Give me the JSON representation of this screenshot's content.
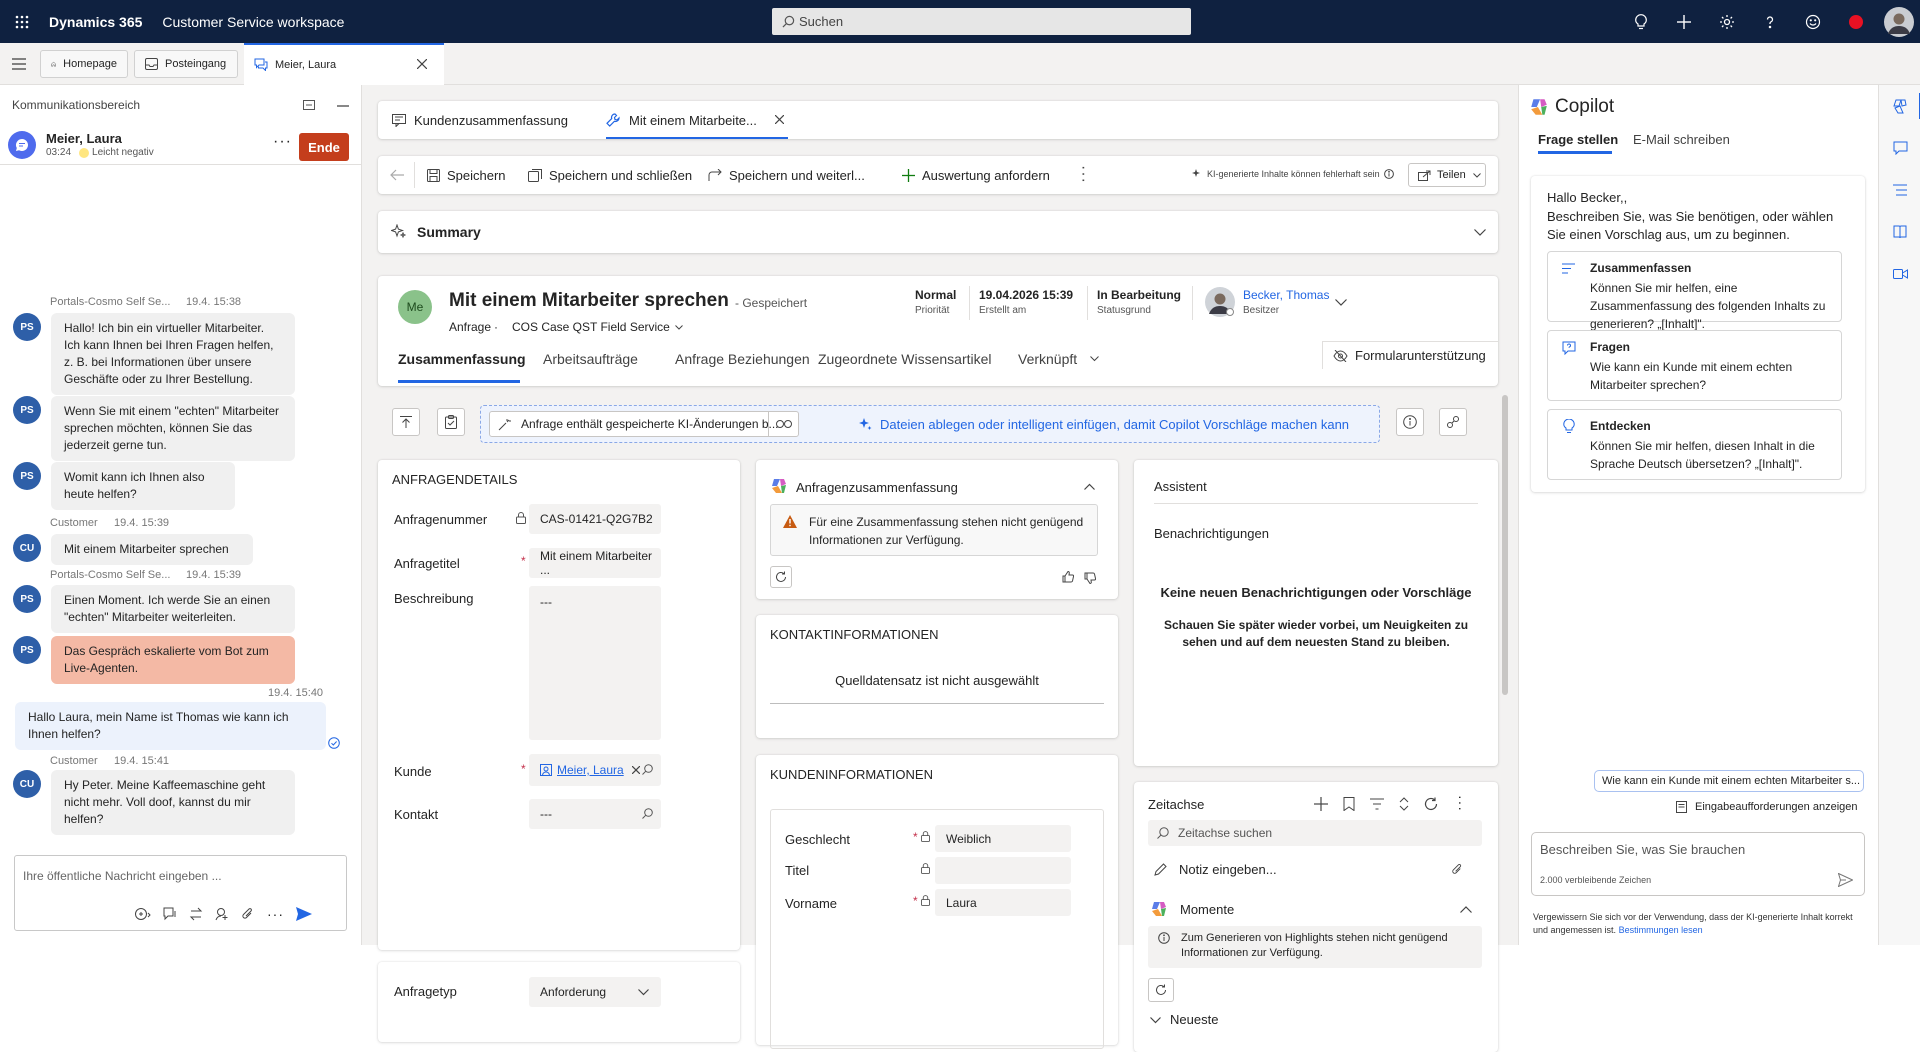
{
  "topbar": {
    "brand": "Dynamics 365",
    "app": "Customer Service workspace",
    "search_placeholder": "Suchen"
  },
  "tabs": {
    "home": "Homepage",
    "inbox": "Posteingang",
    "session": "Meier, Laura"
  },
  "comm": {
    "title": "Kommunikationsbereich",
    "contact_name": "Meier, Laura",
    "contact_time": "03:24",
    "sentiment": "Leicht negativ",
    "end_label": "Ende",
    "input_placeholder": "Ihre öffentliche Nachricht eingeben ...",
    "messages": [
      {
        "sender": "Portals-Cosmo Self Se...",
        "time": "19.4. 15:38",
        "initials": "PS",
        "text": "Hallo! Ich bin ein virtueller Mitarbeiter. Ich kann Ihnen bei Ihren Fragen helfen, z. B. bei Informationen über unsere Geschäfte oder zu Ihrer Bestellung."
      },
      {
        "initials": "PS",
        "text": "Wenn Sie mit einem \"echten\" Mitarbeiter sprechen möchten, können Sie das jederzeit gerne tun."
      },
      {
        "initials": "PS",
        "text": "Womit kann ich Ihnen also heute helfen?"
      },
      {
        "sender": "Customer",
        "time": "19.4. 15:39",
        "initials": "CU",
        "text": "Mit einem Mitarbeiter sprechen"
      },
      {
        "sender": "Portals-Cosmo Self Se...",
        "time": "19.4. 15:39",
        "initials": "PS",
        "text": "Einen Moment. Ich werde Sie an einen \"echten\" Mitarbeiter weiterleiten."
      },
      {
        "initials": "PS",
        "text": "Das Gespräch eskalierte vom Bot zum Live-Agenten."
      },
      {
        "time": "19.4. 15:40",
        "text": "Hallo Laura, mein Name ist Thomas wie kann ich Ihnen helfen?"
      },
      {
        "sender": "Customer",
        "time": "19.4. 15:41",
        "initials": "CU",
        "text": "Hy Peter. Meine Kaffeemaschine geht nicht mehr. Voll doof, kannst du mir helfen?"
      }
    ]
  },
  "form": {
    "subtabs": {
      "summary": "Kundenzusammenfassung",
      "current": "Mit einem Mitarbeite..."
    },
    "toolbar": {
      "save": "Speichern",
      "save_close": "Speichern und schließen",
      "save_next": "Speichern und weiterl...",
      "request_eval": "Auswertung anfordern",
      "ai_note": "KI-generierte Inhalte können fehlerhaft sein",
      "share": "Teilen"
    },
    "summary_label": "Summary",
    "header": {
      "initials": "Me",
      "title": "Mit einem Mitarbeiter sprechen",
      "saved": "- Gespeichert",
      "entity": "Anfrage",
      "formname": "COS Case QST Field Service",
      "priority_value": "Normal",
      "priority_label": "Priorität",
      "created_value": "19.04.2026 15:39",
      "created_label": "Erstellt am",
      "status_value": "In Bearbeitung",
      "status_label": "Statusgrund",
      "owner_value": "Becker, Thomas",
      "owner_label": "Besitzer"
    },
    "tabs": [
      "Zusammenfassung",
      "Arbeitsaufträge",
      "Anfrage Beziehungen",
      "Zugeordnete Wissensartikel",
      "Verknüpft"
    ],
    "form_assist": "Formularunterstützung",
    "ai_banner": "Anfrage enthält gespeicherte KI-Änderungen b...",
    "drop_hint": "Dateien ablegen oder intelligent einfügen, damit Copilot Vorschläge machen kann",
    "details": {
      "title": "ANFRAGENDETAILS",
      "number_label": "Anfragenummer",
      "number_value": "CAS-01421-Q2G7B2",
      "title_label": "Anfragetitel",
      "title_value": "Mit einem Mitarbeiter ...",
      "desc_label": "Beschreibung",
      "desc_value": "---",
      "customer_label": "Kunde",
      "customer_value": "Meier, Laura",
      "contact_label": "Kontakt",
      "contact_value": "---",
      "type_label": "Anfragetyp",
      "type_value": "Anforderung"
    },
    "case_summary": {
      "title": "Anfragenzusammenfassung",
      "warning": "Für eine Zusammenfassung stehen nicht genügend Informationen zur Verfügung."
    },
    "contact_info": {
      "title": "KONTAKTINFORMATIONEN",
      "empty": "Quelldatensatz ist nicht ausgewählt"
    },
    "customer_info": {
      "title": "KUNDENINFORMATIONEN",
      "gender_label": "Geschlecht",
      "gender_value": "Weiblich",
      "titel_label": "Titel",
      "firstname_label": "Vorname",
      "firstname_value": "Laura"
    },
    "assistant": {
      "title": "Assistent",
      "notifications": "Benachrichtigungen",
      "empty_title": "Keine neuen Benachrichtigungen oder Vorschläge",
      "empty_desc": "Schauen Sie später wieder vorbei, um Neuigkeiten zu sehen und auf dem neuesten Stand zu bleiben."
    },
    "timeline": {
      "title": "Zeitachse",
      "search_placeholder": "Zeitachse suchen",
      "note_placeholder": "Notiz eingeben...",
      "moments": "Momente",
      "moments_info": "Zum Generieren von Highlights stehen nicht genügend Informationen zur Verfügung.",
      "newest": "Neueste"
    }
  },
  "copilot": {
    "title": "Copilot",
    "tab_ask": "Frage stellen",
    "tab_email": "E-Mail schreiben",
    "greeting": "Hallo Becker,,",
    "intro": "Beschreiben Sie, was Sie benötigen, oder wählen Sie einen Vorschlag aus, um zu beginnen.",
    "suggestions": [
      {
        "title": "Zusammenfassen",
        "desc": "Können Sie mir helfen, eine Zusammenfassung des folgenden Inhalts zu generieren? „[Inhalt]\"."
      },
      {
        "title": "Fragen",
        "desc": "Wie kann ein Kunde mit einem echten Mitarbeiter sprechen?"
      },
      {
        "title": "Entdecken",
        "desc": "Können Sie mir helfen, diesen Inhalt in die Sprache Deutsch übersetzen? „[Inhalt]\"."
      }
    ],
    "chip": "Wie kann ein Kunde mit einem echten Mitarbeiter s...",
    "show_prompts": "Eingabeaufforderungen anzeigen",
    "input_placeholder": "Beschreiben Sie, was Sie brauchen",
    "chars_left": "2.000 verbleibende Zeichen",
    "disclaimer": "Vergewissern Sie sich vor der Verwendung, dass der KI-generierte Inhalt korrekt und angemessen ist.",
    "terms": "Bestimmungen lesen"
  },
  "colors": {
    "topbar": "#0f2140",
    "accent": "#2266e3",
    "end_button": "#c43e1c",
    "escalation": "#f4b9a5"
  }
}
